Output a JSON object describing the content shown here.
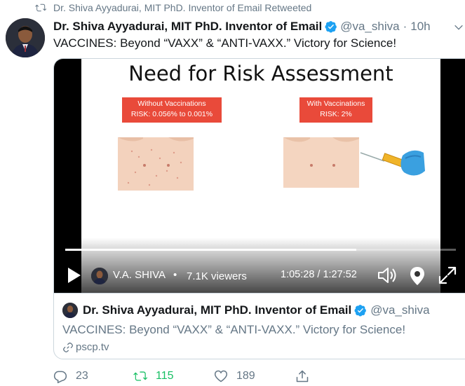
{
  "retweet_banner": {
    "text": "Dr. Shiva Ayyadurai, MIT PhD. Inventor of Email Retweeted",
    "icon": "retweet-icon"
  },
  "tweet": {
    "author_name": "Dr. Shiva Ayyadurai, MIT PhD. Inventor of Email",
    "handle": "@va_shiva",
    "separator": "·",
    "time": "10h",
    "text": "VACCINES: Beyond “VAXX” & “ANTI-VAXX.” Victory for Science!"
  },
  "video": {
    "slide_title": "Need for Risk Assessment",
    "left_box": {
      "line1": "Without Vaccinations",
      "line2": "RISK: 0.056% to 0.001%"
    },
    "right_box": {
      "line1": "With Vaccinations",
      "line2": "RISK: 2%"
    },
    "host_name": "V.A. SHIVA",
    "bullet": "•",
    "viewers": "7.1K viewers",
    "timecode": "1:05:28 / 1:27:52",
    "progress_fraction": 0.745
  },
  "card": {
    "author_name": "Dr. Shiva Ayyadurai, MIT PhD. Inventor of Email",
    "handle": "@va_shiva",
    "text": "VACCINES: Beyond “VAXX” & “ANTI-VAXX.” Victory for Science!",
    "link": "pscp.tv"
  },
  "actions": {
    "replies": "23",
    "retweets": "115",
    "likes": "189"
  },
  "colors": {
    "accent": "#1da1f2",
    "retweet_green": "#17bf63",
    "muted": "#657786",
    "risk_red": "#e94a3a"
  }
}
